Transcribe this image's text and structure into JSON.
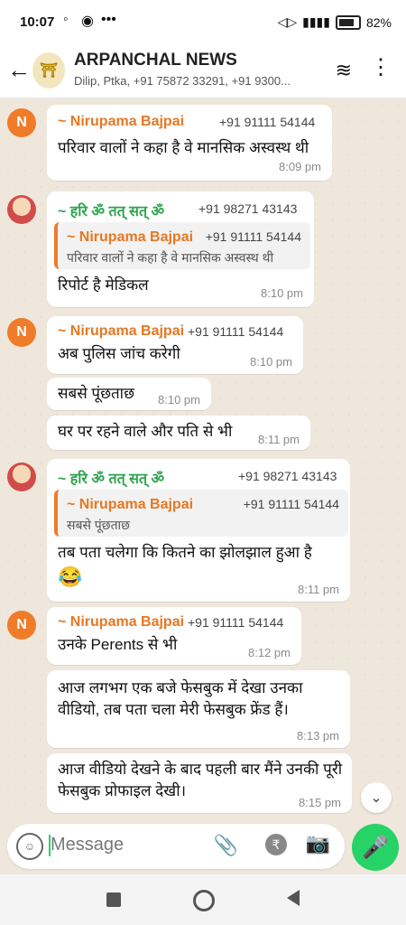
{
  "status": {
    "time": "10:07",
    "battery": "82%"
  },
  "header": {
    "title": "ARPANCHAL NEWS",
    "subtitle": "Dilip, Ptka, +91 75872 33291, +91 9300..."
  },
  "messages": [
    {
      "sender": "~ Nirupama Bajpai",
      "phone": "+91 91111 54144",
      "text": "परिवार वालों ने कहा है वे मानसिक अस्वस्थ थी",
      "time": "8:09 pm"
    },
    {
      "sender": "~ हरि ॐ तत् सत् ॐ",
      "phone": "+91 98271 43143",
      "quote_name": "~ Nirupama Bajpai",
      "quote_phone": "+91 91111 54144",
      "quote_text": "परिवार वालों ने कहा है वे मानसिक अस्वस्थ थी",
      "text": "रिपोर्ट है मेडिकल",
      "time": "8:10 pm"
    },
    {
      "sender": "~ Nirupama Bajpai",
      "phone": "+91 91111 54144",
      "text": "अब पुलिस जांच करेगी",
      "time": "8:10 pm"
    },
    {
      "text": "सबसे पूंछताछ",
      "time": "8:10 pm"
    },
    {
      "text": "घर पर रहने वाले और पति से भी",
      "time": "8:11 pm"
    },
    {
      "sender": "~ हरि ॐ तत् सत् ॐ",
      "phone": "+91 98271 43143",
      "quote_name": "~ Nirupama Bajpai",
      "quote_phone": "+91 91111 54144",
      "quote_text": "सबसे पूंछताछ",
      "text": "तब पता चलेगा कि कितने का झोलझाल हुआ है",
      "emoji": "😂",
      "time": "8:11 pm"
    },
    {
      "sender": "~ Nirupama Bajpai",
      "phone": "+91 91111 54144",
      "text": "उनके Perents से भी",
      "time": "8:12 pm"
    },
    {
      "text": "आज लगभग एक बजे फेसबुक में देखा उनका वीडियो, तब पता चला मेरी फेसबुक फ्रेंड हैं।",
      "time": "8:13 pm"
    },
    {
      "text": "आज वीडियो देखने के बाद पहली बार मैंने उनकी पूरी फेसबुक प्रोफाइल देखी।",
      "time": "8:15 pm"
    }
  ],
  "composer": {
    "placeholder": "Message"
  },
  "icons": {
    "back": "back-arrow-icon",
    "wave": "audio-wave-icon",
    "menu": "more-vert-icon",
    "emoji": "emoji-icon",
    "attach": "paperclip-icon",
    "rupee": "rupee-icon",
    "camera": "camera-icon",
    "mic": "mic-icon",
    "scroll": "scroll-down-icon"
  }
}
